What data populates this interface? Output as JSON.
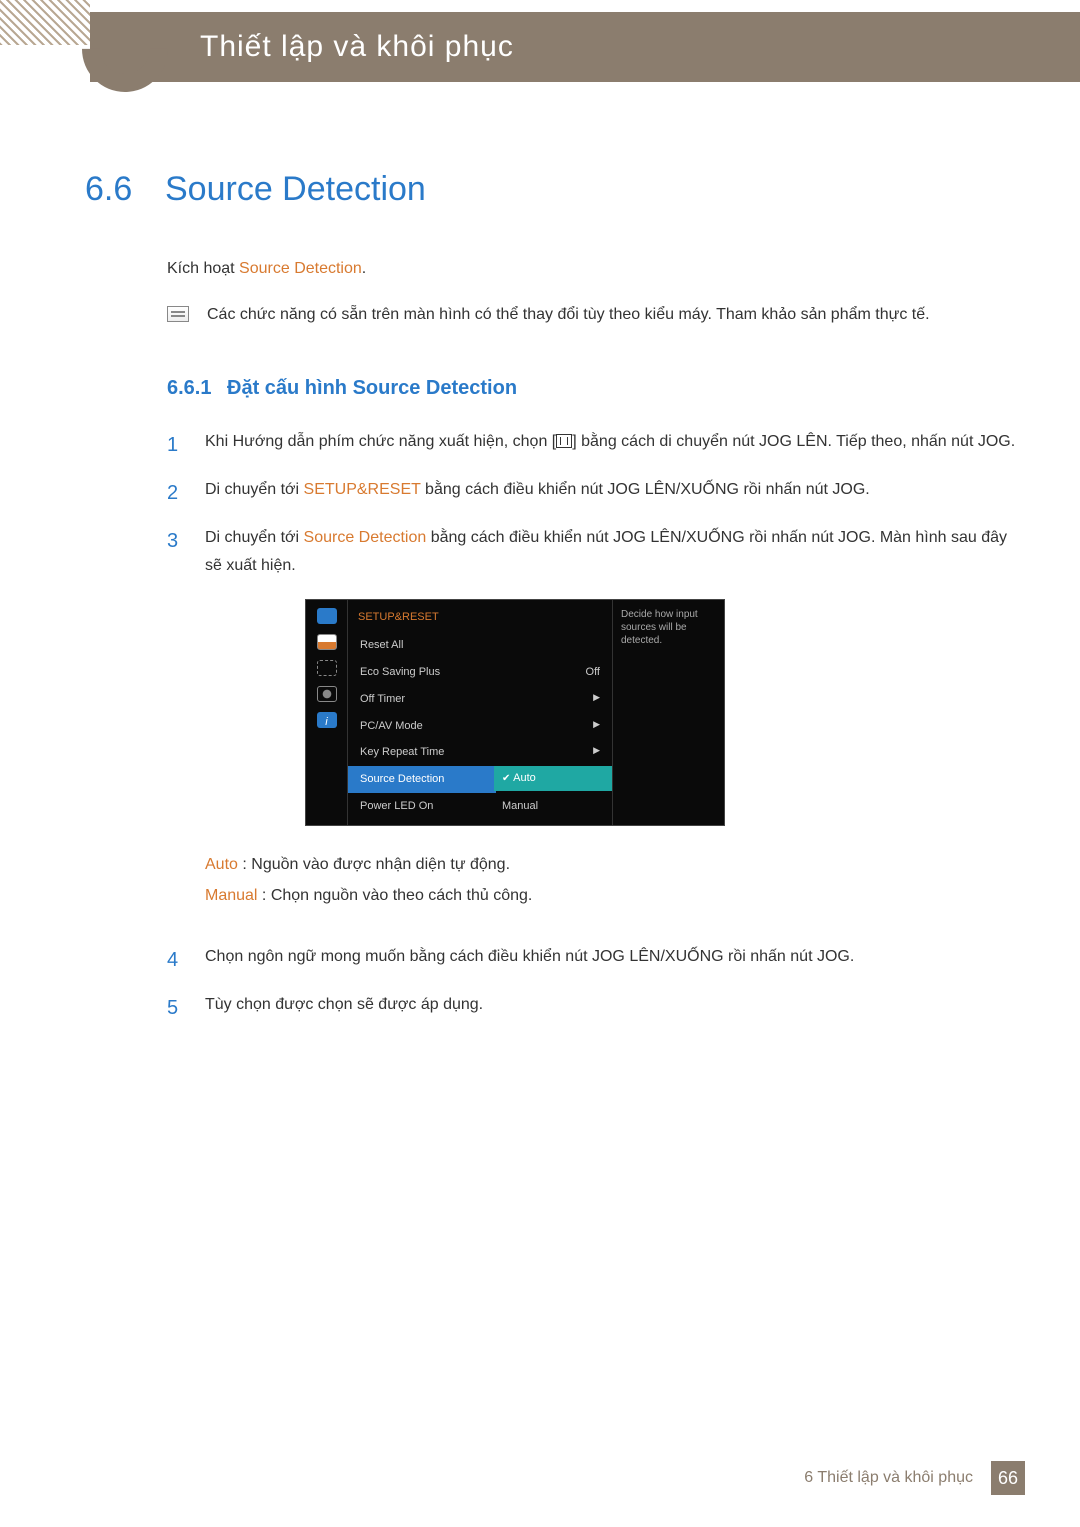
{
  "chapter": {
    "title": "Thiết lập và khôi phục"
  },
  "section": {
    "number": "6.6",
    "title": "Source Detection"
  },
  "intro": {
    "prefix": "Kích hoạt ",
    "highlight": "Source Detection",
    "suffix": "."
  },
  "note": "Các chức năng có sẵn trên màn hình có thể thay đổi tùy theo kiểu máy. Tham khảo sản phẩm thực tế.",
  "subsection": {
    "number": "6.6.1",
    "title": "Đặt cấu hình Source Detection"
  },
  "steps": {
    "s1a": "Khi Hướng dẫn phím chức năng xuất hiện, chọn [",
    "s1b": "] bằng cách di chuyển nút JOG LÊN. Tiếp theo, nhấn nút JOG.",
    "s2a": "Di chuyển tới ",
    "s2hl": "SETUP&RESET",
    "s2b": " bằng cách điều khiển nút JOG LÊN/XUỐNG rồi nhấn nút JOG.",
    "s3a": "Di chuyển tới ",
    "s3hl": "Source Detection",
    "s3b": " bằng cách điều khiển nút JOG LÊN/XUỐNG rồi nhấn nút JOG. Màn hình sau đây sẽ xuất hiện.",
    "s4": "Chọn ngôn ngữ mong muốn bằng cách điều khiển nút JOG LÊN/XUỐNG rồi nhấn nút JOG.",
    "s5": "Tùy chọn được chọn sẽ được áp dụng."
  },
  "osd": {
    "title": "SETUP&RESET",
    "items": {
      "reset": "Reset All",
      "eco": "Eco Saving Plus",
      "eco_val": "Off",
      "offtimer": "Off Timer",
      "pcav": "PC/AV Mode",
      "keyrep": "Key Repeat Time",
      "srcdet": "Source Detection",
      "powerled": "Power LED On"
    },
    "popup": {
      "auto": "Auto",
      "manual": "Manual"
    },
    "help": "Decide how input sources will be detected."
  },
  "defs": {
    "auto_label": "Auto",
    "auto_text": " : Nguồn vào được nhận diện tự động.",
    "manual_label": "Manual",
    "manual_text": " : Chọn nguồn vào theo cách thủ công."
  },
  "footer": {
    "text": "6 Thiết lập và khôi phục",
    "page": "66"
  }
}
